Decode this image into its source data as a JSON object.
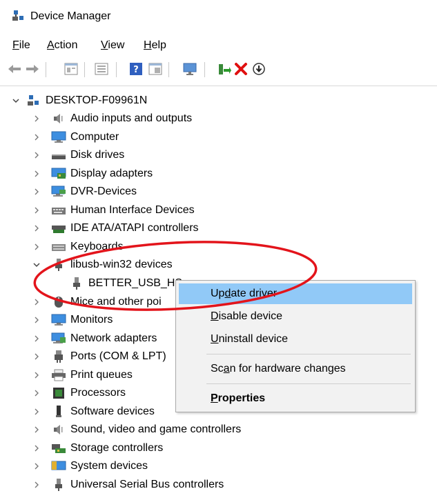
{
  "window": {
    "title": "Device Manager"
  },
  "menu": {
    "file": {
      "mnemonic": "F",
      "rest": "ile"
    },
    "action": {
      "mnemonic": "A",
      "rest": "ction"
    },
    "view": {
      "mnemonic": "V",
      "rest": "iew"
    },
    "help": {
      "mnemonic": "H",
      "rest": "elp"
    }
  },
  "toolbar": {
    "icons": [
      "back-arrow-icon",
      "forward-arrow-icon",
      "properties-icon",
      "update-icon",
      "help-icon",
      "show-hidden-icon",
      "monitor-icon",
      "update-driver-icon",
      "uninstall-icon",
      "download-icon"
    ]
  },
  "tree": {
    "root": "DESKTOP-F09961N",
    "items": [
      {
        "label": "Audio inputs and outputs",
        "icon": "speaker-icon"
      },
      {
        "label": "Computer",
        "icon": "computer-icon"
      },
      {
        "label": "Disk drives",
        "icon": "disk-drive-icon"
      },
      {
        "label": "Display adapters",
        "icon": "display-adapter-icon"
      },
      {
        "label": "DVR-Devices",
        "icon": "dvr-icon"
      },
      {
        "label": "Human Interface Devices",
        "icon": "hid-icon"
      },
      {
        "label": "IDE ATA/ATAPI controllers",
        "icon": "ide-controller-icon"
      },
      {
        "label": "Keyboards",
        "icon": "keyboard-icon"
      },
      {
        "label": "libusb-win32 devices",
        "icon": "usb-plug-icon",
        "expanded": true
      },
      {
        "label": "BETTER_USB_HS",
        "icon": "usb-plug-icon",
        "child": true
      },
      {
        "label": "Mice and other poi",
        "icon": "mouse-icon"
      },
      {
        "label": "Monitors",
        "icon": "monitor-icon"
      },
      {
        "label": "Network adapters",
        "icon": "network-adapter-icon"
      },
      {
        "label": "Ports (COM & LPT)",
        "icon": "port-icon"
      },
      {
        "label": "Print queues",
        "icon": "printer-icon"
      },
      {
        "label": "Processors",
        "icon": "processor-icon"
      },
      {
        "label": "Software devices",
        "icon": "software-device-icon"
      },
      {
        "label": "Sound, video and game controllers",
        "icon": "speaker-icon"
      },
      {
        "label": "Storage controllers",
        "icon": "storage-controller-icon"
      },
      {
        "label": "System devices",
        "icon": "system-device-icon"
      },
      {
        "label": "Universal Serial Bus controllers",
        "icon": "usb-plug-icon"
      }
    ]
  },
  "context_menu": {
    "update_driver": {
      "pre": "Up",
      "mn": "d",
      "post": "ate driver"
    },
    "disable_device": {
      "pre": "",
      "mn": "D",
      "post": "isable device"
    },
    "uninstall_device": {
      "pre": "",
      "mn": "U",
      "post": "ninstall device"
    },
    "scan": {
      "pre": "Sc",
      "mn": "a",
      "post": "n for hardware changes"
    },
    "properties": {
      "pre": "",
      "mn": "P",
      "post": "roperties"
    }
  },
  "colors": {
    "highlight": "#91c9f7",
    "annotation_red": "#e3141b",
    "menu_bg": "#f2f2f2"
  }
}
